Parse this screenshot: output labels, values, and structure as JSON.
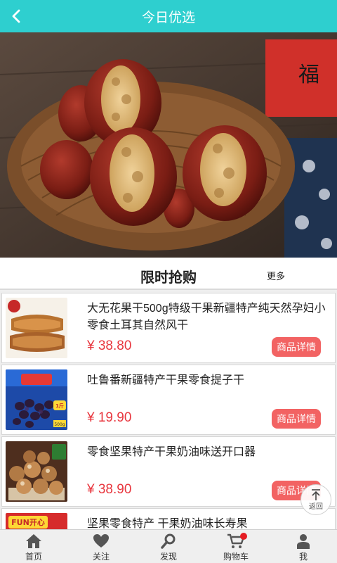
{
  "header": {
    "title": "今日优选",
    "back_icon": "chevron-left-icon"
  },
  "banner": {
    "subject": "red dates stuffed with walnuts in a wicker basket",
    "sign_text": "福"
  },
  "section": {
    "title": "限时抢购",
    "more_label": "更多"
  },
  "products": [
    {
      "name": "大无花果干500g特级干果新疆特产纯天然孕妇小零食土耳其自然风干",
      "price": "¥ 38.80",
      "button": "商品详情"
    },
    {
      "name": "吐鲁番新疆特产干果零食提子干",
      "price": "¥ 19.90",
      "button": "商品详情"
    },
    {
      "name": "零食坚果特产干果奶油味送开口器",
      "price": "¥ 38.90",
      "button": "商品详情"
    },
    {
      "name": "坚果零食特产 干果奶油味长寿果",
      "price": "",
      "button": ""
    }
  ],
  "thumb_text": {
    "raisins_badge": "1斤",
    "raisins_weight": "500g",
    "pistachio_logo": "FUN开心"
  },
  "back_to_top": {
    "label": "返回"
  },
  "tabbar": [
    {
      "label": "首页",
      "icon": "home-icon"
    },
    {
      "label": "关注",
      "icon": "heart-icon"
    },
    {
      "label": "发现",
      "icon": "search-icon"
    },
    {
      "label": "购物车",
      "icon": "cart-icon"
    },
    {
      "label": "我",
      "icon": "user-icon"
    }
  ],
  "colors": {
    "header": "#2ecfcf",
    "price": "#e8373f",
    "button": "#f26363",
    "tabbar": "#efefef",
    "badge": "#e51c23"
  }
}
